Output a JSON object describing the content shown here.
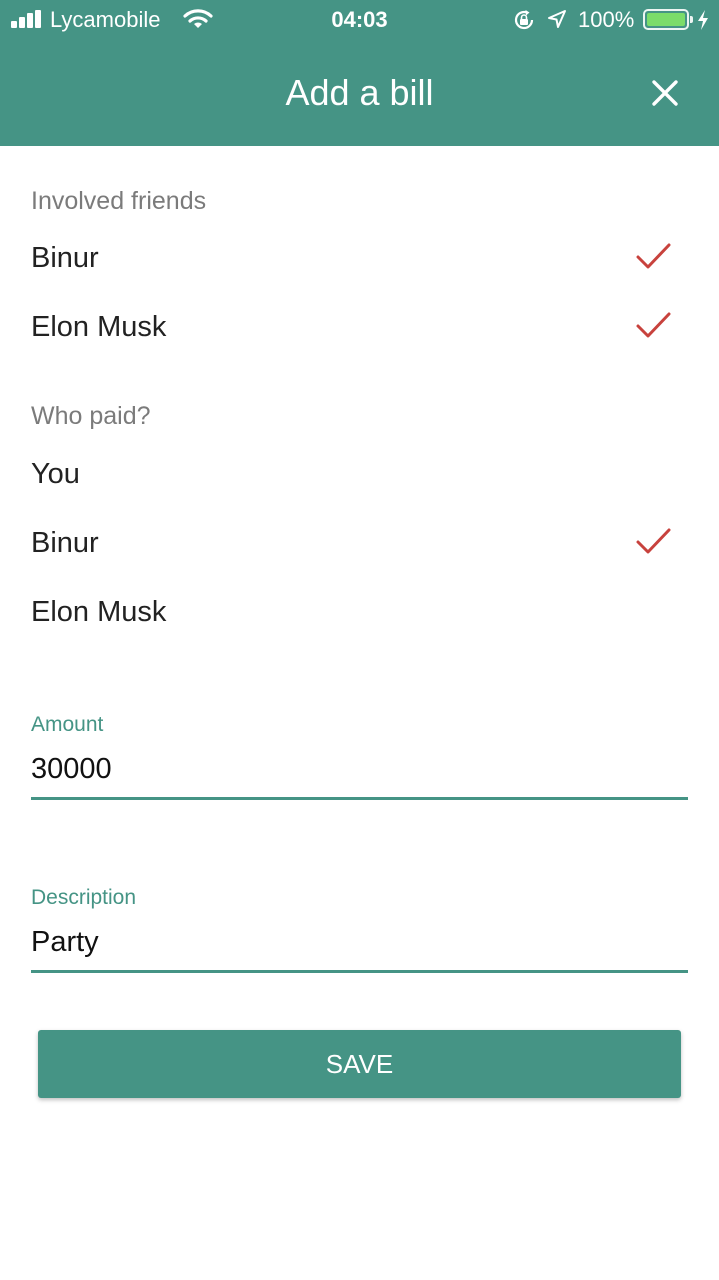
{
  "status_bar": {
    "carrier": "Lycamobile",
    "time": "04:03",
    "battery_percent": "100%"
  },
  "header": {
    "title": "Add a bill"
  },
  "involved": {
    "label": "Involved friends",
    "items": [
      {
        "name": "Binur",
        "checked": true
      },
      {
        "name": "Elon Musk",
        "checked": true
      }
    ]
  },
  "paid": {
    "label": "Who paid?",
    "items": [
      {
        "name": "You",
        "checked": false
      },
      {
        "name": "Binur",
        "checked": true
      },
      {
        "name": "Elon Musk",
        "checked": false
      }
    ]
  },
  "amount": {
    "label": "Amount",
    "value": "30000"
  },
  "description": {
    "label": "Description",
    "value": "Party"
  },
  "save_label": "SAVE",
  "colors": {
    "accent": "#459485",
    "check": "#c8423d"
  }
}
